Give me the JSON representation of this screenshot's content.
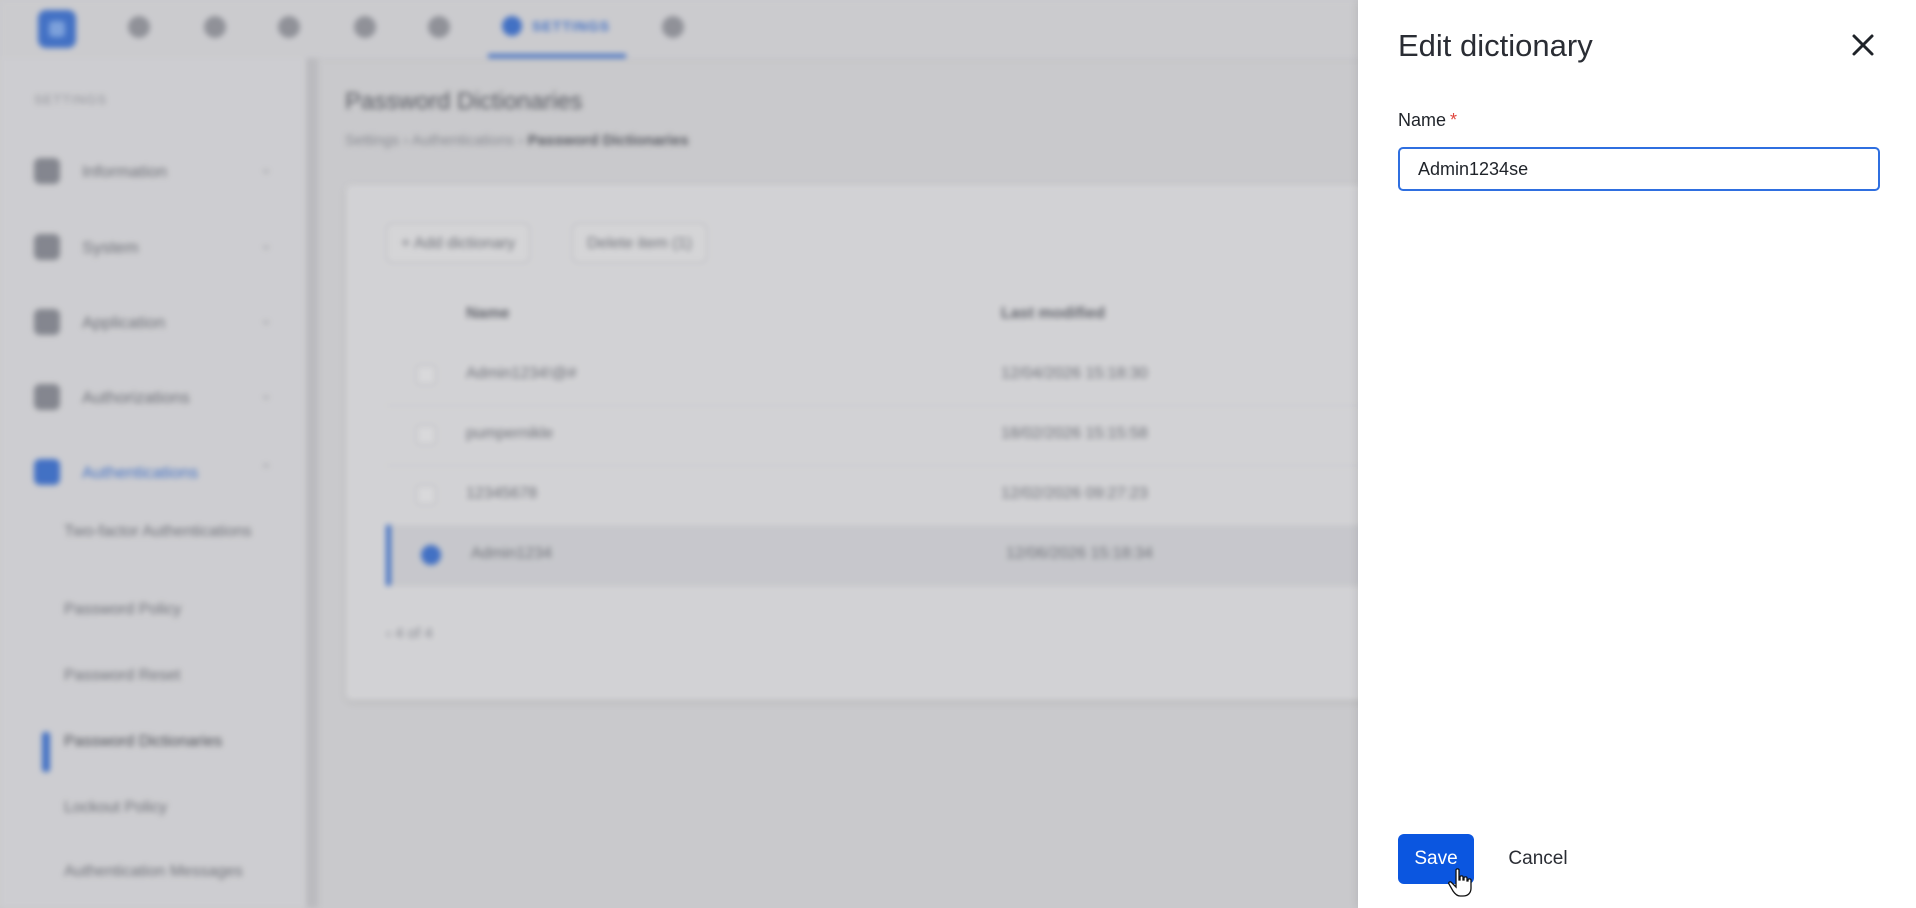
{
  "background": {
    "top_tab_label": "SETTINGS",
    "sidebar": {
      "caption": "SETTINGS",
      "items": [
        {
          "label": "Information",
          "icon": "info-icon"
        },
        {
          "label": "System",
          "icon": "system-icon"
        },
        {
          "label": "Application",
          "icon": "application-icon"
        },
        {
          "label": "Authorizations",
          "icon": "shield-icon"
        },
        {
          "label": "Authentications",
          "icon": "shield-icon"
        }
      ],
      "subitems": [
        {
          "label": "Two-factor Authentications"
        },
        {
          "label": "Password Policy"
        },
        {
          "label": "Password Reset"
        },
        {
          "label": "Password Dictionaries"
        },
        {
          "label": "Lockout Policy"
        },
        {
          "label": "Authentication Messages"
        }
      ]
    },
    "page_title": "Password Dictionaries",
    "breadcrumb": [
      "Settings",
      "Authentications",
      "Password Dictionaries"
    ],
    "toolbar": {
      "add_label": "+ Add dictionary",
      "delete_label": "Delete item (1)"
    },
    "table": {
      "columns": [
        "Name",
        "Last modified"
      ],
      "rows": [
        {
          "name": "Admin1234!@#",
          "modified": "12/04/2026 15:18:30"
        },
        {
          "name": "pumpernikle",
          "modified": "18/02/2026 15:15:58"
        },
        {
          "name": "12345678",
          "modified": "12/02/2026 09:27:23"
        },
        {
          "name": "Admin1234",
          "modified": "12/06/2026 15:18:34"
        }
      ],
      "pagination": "4 of 4"
    }
  },
  "drawer": {
    "title": "Edit dictionary",
    "name_label": "Name",
    "required_mark": "*",
    "name_value": "Admin1234se",
    "save_label": "Save",
    "cancel_label": "Cancel"
  },
  "colors": {
    "accent": "#0b56e0",
    "required": "#e0463d"
  }
}
